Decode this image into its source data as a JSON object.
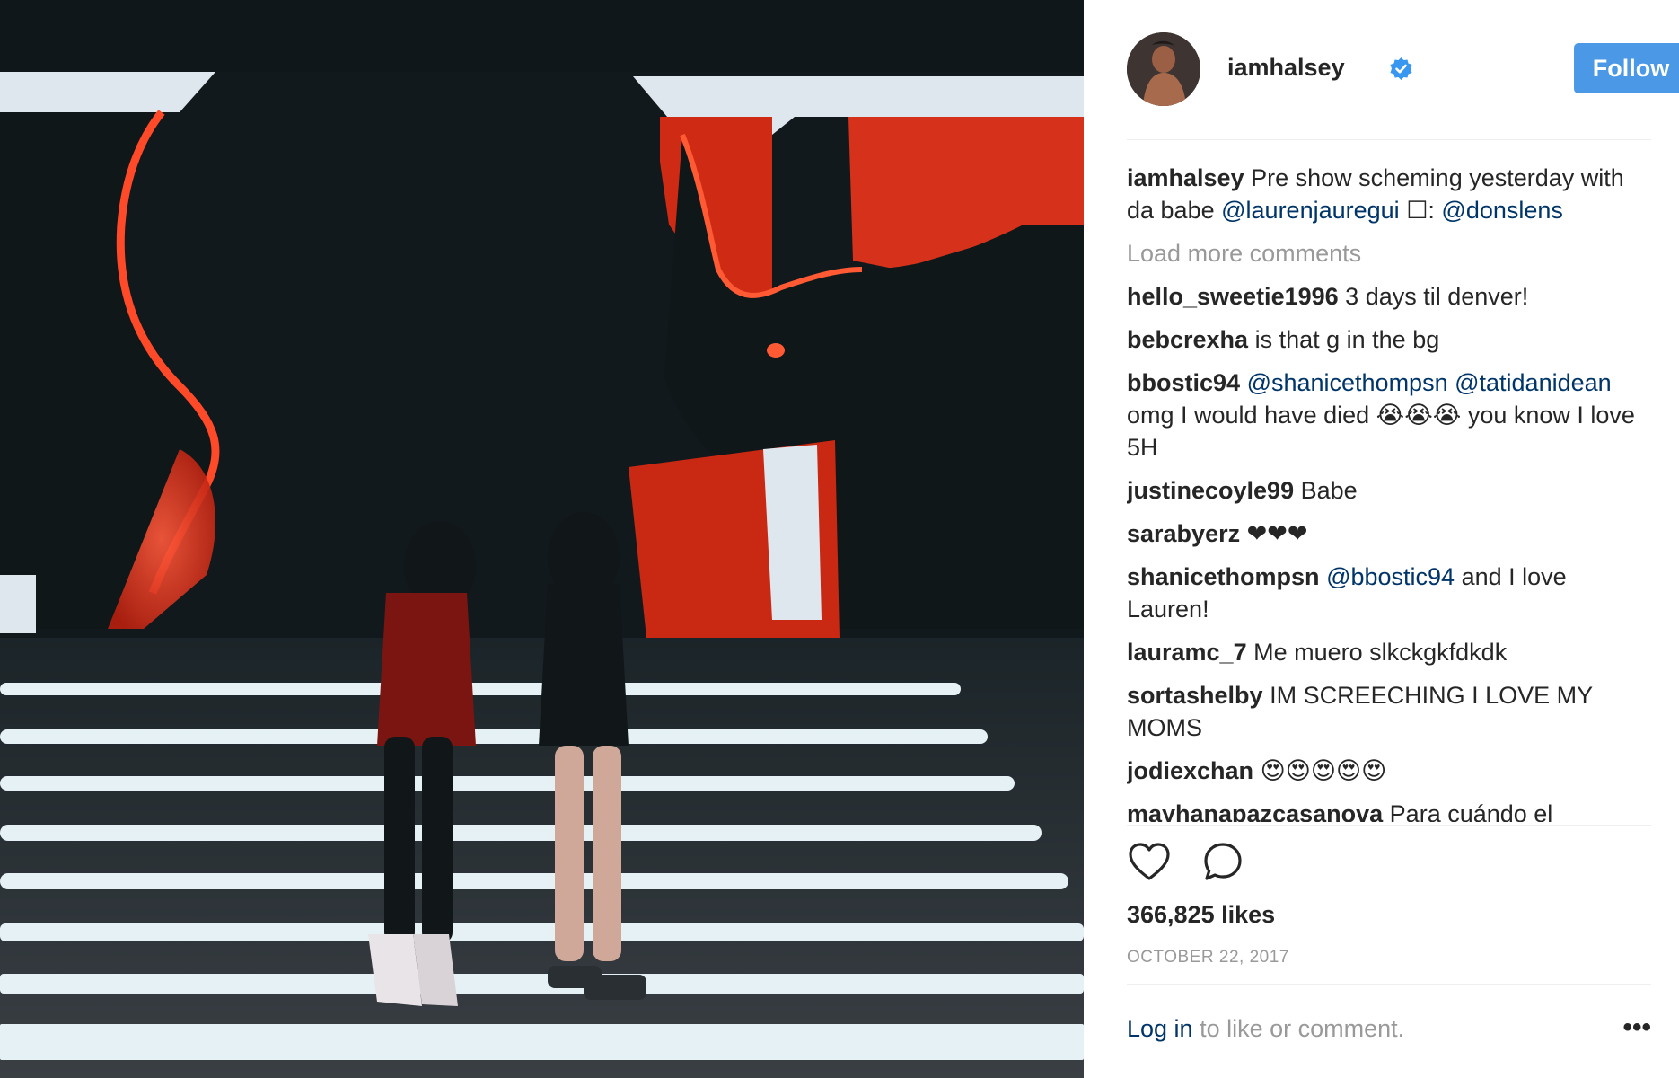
{
  "post": {
    "username": "iamhalsey",
    "follow_label": "Follow",
    "caption": {
      "username": "iamhalsey",
      "text": "Pre show scheming yesterday with da babe",
      "mention1": "@laurenjauregui",
      "camera_glyph": "☐:",
      "mention2": "@donslens"
    },
    "load_more": "Load more comments",
    "comments": [
      {
        "user": "hello_sweetie1996",
        "text": "3 days til denver!"
      },
      {
        "user": "bebcrexha",
        "text": "is that g in the bg"
      },
      {
        "user": "bbostic94",
        "mention1": "@shanicethompsn",
        "mention2": "@tatidanidean",
        "text": "omg I would have died 😭😭😭 you know I love 5H"
      },
      {
        "user": "justinecoyle99",
        "text": "Babe"
      },
      {
        "user": "sarabyerz",
        "text": "❤❤❤"
      },
      {
        "user": "shanicethompsn",
        "mention": "@bbostic94",
        "text": "and I love Lauren!"
      },
      {
        "user": "lauramc_7",
        "text": "Me muero slkckgkfdkdk"
      },
      {
        "user": "sortashelby",
        "text": "IM SCREECHING I LOVE MY MOMS"
      },
      {
        "user": "jodiexchan",
        "text": "😍😍😍😍😍"
      },
      {
        "user": "mayhanapazcasanova",
        "text": "Para cuándo el"
      }
    ],
    "likes": "366,825 likes",
    "date": "OCTOBER 22, 2017",
    "login_link": "Log in",
    "login_rest": "to like or comment.",
    "more_glyph": "•••"
  },
  "icons": {
    "heart": "heart-icon",
    "comment": "comment-bubble-icon",
    "verified": "verified-badge-icon"
  },
  "colors": {
    "follow_button": "#4a98e6",
    "verified": "#3897f0",
    "mention": "#003569",
    "muted": "#999999",
    "text": "#262626"
  }
}
